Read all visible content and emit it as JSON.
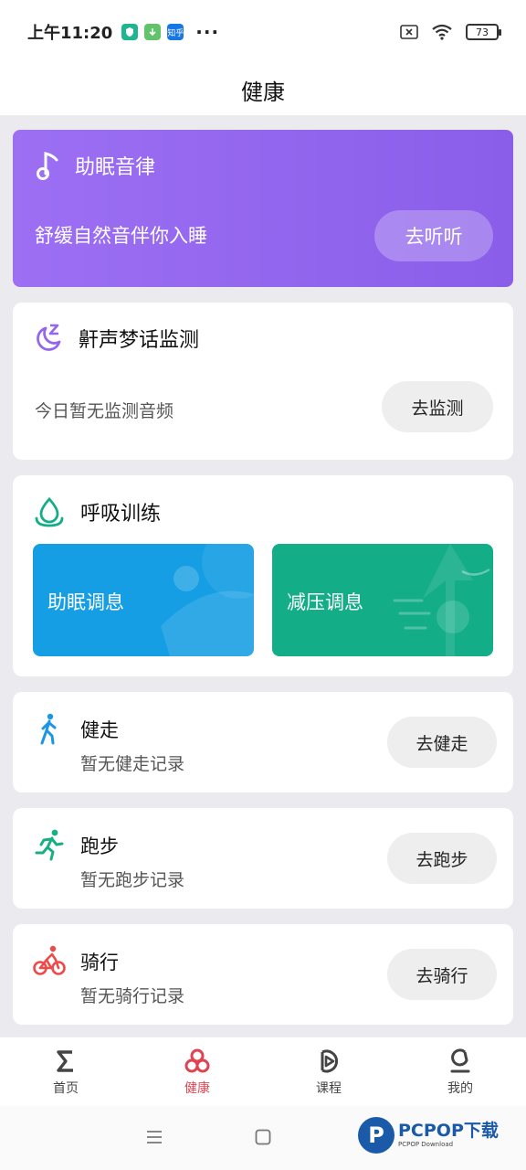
{
  "status_bar": {
    "time": "上午11:20",
    "apps": [
      {
        "icon": "shield-app-icon",
        "color": "#1fb68f",
        "text": ""
      },
      {
        "icon": "download-app-icon",
        "color": "#62c36a",
        "text": ""
      },
      {
        "icon": "zhihu-app-icon",
        "color": "#1677e5",
        "text": "知乎"
      }
    ],
    "more": "···",
    "battery": "73"
  },
  "header": {
    "title": "健康"
  },
  "sleep_music": {
    "title": "助眠音律",
    "description": "舒缓自然音伴你入睡",
    "button": "去听听",
    "icon": "music-note-icon"
  },
  "snore": {
    "title": "鼾声梦话监测",
    "description": "今日暂无监测音频",
    "button": "去监测",
    "icon": "moon-z-icon"
  },
  "breathing": {
    "title": "呼吸训练",
    "icon": "water-drop-icon",
    "tiles": [
      {
        "label": "助眠调息",
        "color": "#159ee3"
      },
      {
        "label": "减压调息",
        "color": "#13ad88"
      }
    ]
  },
  "activities": [
    {
      "name": "健走",
      "subtitle": "暂无健走记录",
      "button": "去健走",
      "icon": "walking-icon",
      "color": "#1a95e8"
    },
    {
      "name": "跑步",
      "subtitle": "暂无跑步记录",
      "button": "去跑步",
      "icon": "running-icon",
      "color": "#18b083"
    },
    {
      "name": "骑行",
      "subtitle": "暂无骑行记录",
      "button": "去骑行",
      "icon": "cycling-icon",
      "color": "#ef4a4a"
    }
  ],
  "tabs": [
    {
      "label": "首页",
      "icon": "sigma-home-icon",
      "active": false
    },
    {
      "label": "健康",
      "icon": "health-rings-icon",
      "active": true
    },
    {
      "label": "课程",
      "icon": "course-play-icon",
      "active": false
    },
    {
      "label": "我的",
      "icon": "profile-icon",
      "active": false
    }
  ],
  "watermark": {
    "logo": "P",
    "text": "PCPOP下载",
    "sub": "PCPOP Download"
  },
  "colors": {
    "accent": "#e04452",
    "purple": "#9c6ff3"
  }
}
